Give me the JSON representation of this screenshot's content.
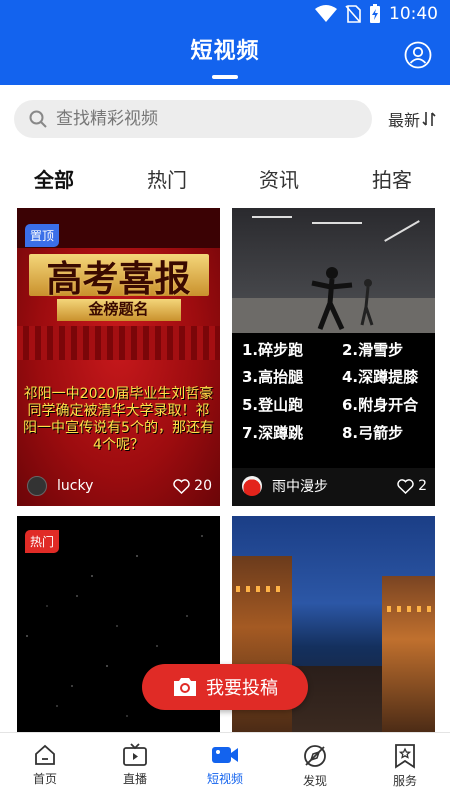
{
  "status_bar": {
    "time": "10:40"
  },
  "header": {
    "title": "短视频"
  },
  "search": {
    "placeholder": "查找精彩视频",
    "sort_label": "最新"
  },
  "tabs": [
    {
      "label": "全部",
      "active": true
    },
    {
      "label": "热门",
      "active": false
    },
    {
      "label": "资讯",
      "active": false
    },
    {
      "label": "拍客",
      "active": false
    }
  ],
  "videos": [
    {
      "badge": "置顶",
      "badge_color": "#3a6fe8",
      "poster_title": "高考喜报",
      "poster_subtitle": "金榜题名",
      "poster_text": "祁阳一中2020届毕业生刘哲豪同学确定被清华大学录取！祁阳一中宣传说有5个的，那还有4个呢？",
      "author": "lucky",
      "likes": "20"
    },
    {
      "steps": [
        "1.碎步跑",
        "2.滑雪步",
        "3.高抬腿",
        "4.深蹲提膝",
        "5.登山跑",
        "6.附身开合",
        "7.深蹲跳",
        "8.弓箭步"
      ],
      "author": "雨中漫步",
      "likes": "2"
    },
    {
      "badge": "热门",
      "badge_color": "#e02b26"
    },
    {}
  ],
  "fab": {
    "label": "我要投稿"
  },
  "bottom_nav": [
    {
      "label": "首页",
      "icon": "home-icon",
      "active": false
    },
    {
      "label": "直播",
      "icon": "tv-icon",
      "active": false
    },
    {
      "label": "短视频",
      "icon": "video-camera-icon",
      "active": true
    },
    {
      "label": "发现",
      "icon": "compass-icon",
      "active": false
    },
    {
      "label": "服务",
      "icon": "service-icon",
      "active": false
    }
  ],
  "colors": {
    "primary": "#1363ee",
    "accent_red": "#e02b26",
    "gold": "#ffe14a"
  }
}
